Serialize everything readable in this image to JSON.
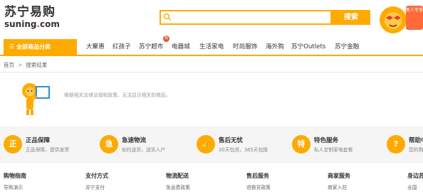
{
  "brand": {
    "name_cn": "苏宁易购",
    "name_en_prefix": "suning",
    "name_en_dot": ".",
    "name_en_suffix": "com"
  },
  "search": {
    "placeholder": "",
    "button_label": "搜索"
  },
  "promo": {
    "tag_text": "新人专享"
  },
  "nav": {
    "category_label": "全部商品分类",
    "items": [
      "大聚惠",
      "红孩子",
      "苏宁超市",
      "电器城",
      "生活家电",
      "时尚服饰",
      "海外购",
      "苏宁Outlets",
      "苏宁金融"
    ],
    "hot_badge": "热"
  },
  "breadcrumb": {
    "home": "首页",
    "separator": ">",
    "current": "搜索结果"
  },
  "no_result": {
    "message": "根据相关法律法规和政策，无法显示相关的商品。"
  },
  "services": [
    {
      "icon": "正",
      "title": "正品保障",
      "subtitle": "正品保障，提供发票"
    },
    {
      "icon": "急",
      "title": "急速物流",
      "subtitle": "如约送货，送货入户"
    },
    {
      "icon": "👍",
      "title": "售后无忧",
      "subtitle": "30天包退，365天包换"
    },
    {
      "icon": "特",
      "title": "特色服务",
      "subtitle": "私人定制家电套餐"
    },
    {
      "icon": "?",
      "title": "帮助中心",
      "subtitle": "您的购物指南"
    }
  ],
  "footer": [
    {
      "head": "购物指南",
      "link": "导购演示"
    },
    {
      "head": "支付方式",
      "link": "苏宁支付"
    },
    {
      "head": "物流配送",
      "link": "免运费政策"
    },
    {
      "head": "售后服务",
      "link": "退换货政策"
    },
    {
      "head": "商家服务",
      "link": "商家入驻"
    },
    {
      "head": "身边苏宁",
      "link": "全国"
    }
  ],
  "colors": {
    "accent": "#ffaa00",
    "service_bg": "#f5f5f5",
    "hot": "#e8533a"
  }
}
